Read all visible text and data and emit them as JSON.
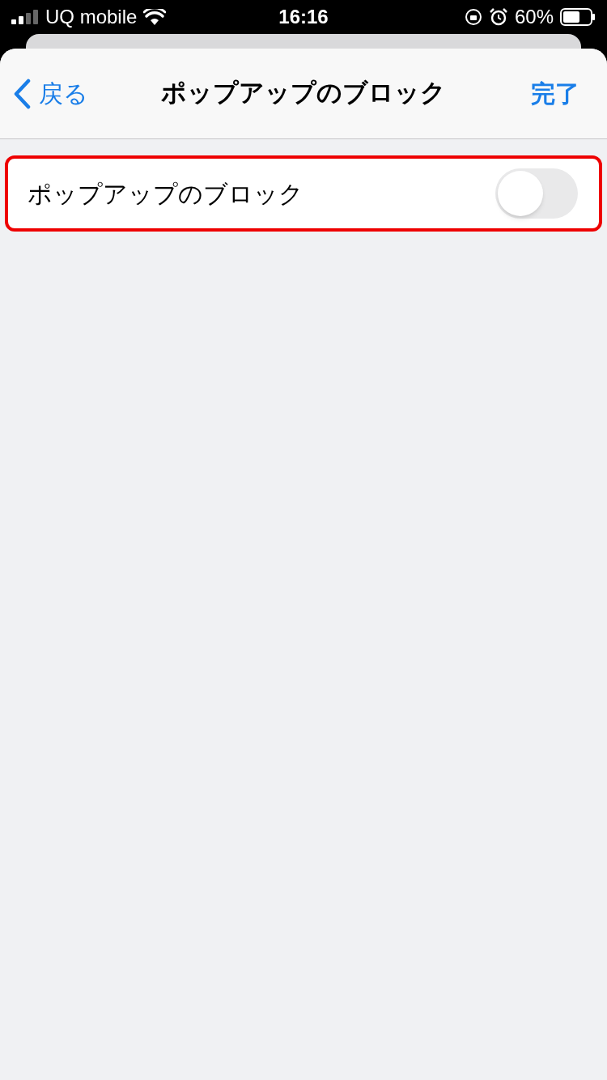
{
  "status_bar": {
    "carrier": "UQ mobile",
    "time": "16:16",
    "battery": "60%"
  },
  "nav": {
    "back": "戻る",
    "title": "ポップアップのブロック",
    "done": "完了"
  },
  "settings": [
    {
      "label": "ポップアップのブロック",
      "on": false,
      "highlighted": true
    }
  ]
}
